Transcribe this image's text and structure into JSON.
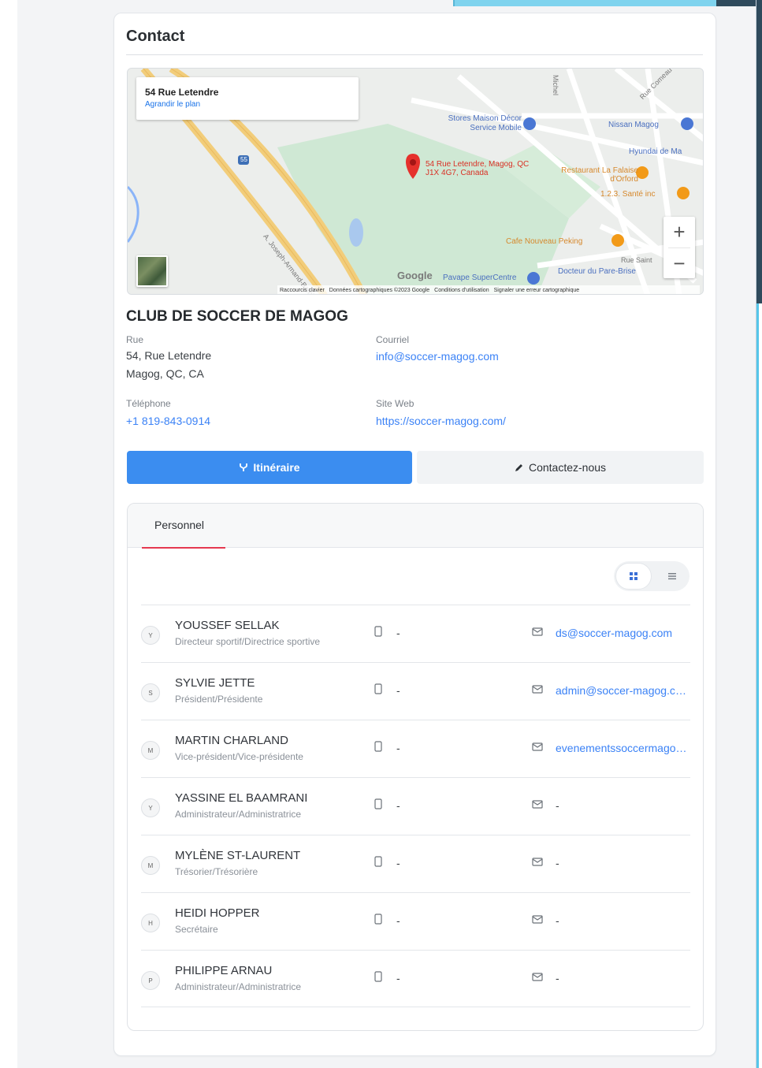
{
  "section": {
    "title": "Contact"
  },
  "map": {
    "info_address": "54 Rue Letendre",
    "info_enlarge": "Agrandir le plan",
    "marker_label": "54 Rue Letendre, Magog, QC J1X 4G7, Canada",
    "pois": [
      "Stores Maison Décor Service Mobile",
      "Nissan Magog",
      "Hyundai de Ma",
      "Restaurant La Falaise d'Orford",
      "1.2.3. Santé inc",
      "Cafe Nouveau Peking",
      "Docteur du Pare-Brise",
      "Pavape SuperCentre"
    ],
    "streets": [
      "A. Joseph-Armand-Bombardier",
      "Rue Saint",
      "Michel",
      "Rue Comeau"
    ],
    "highway": "55",
    "google": "Google",
    "footer": [
      "Raccourcis clavier",
      "Données cartographiques ©2023 Google",
      "Conditions d'utilisation",
      "Signaler une erreur cartographique"
    ],
    "zoom_in": "+",
    "zoom_out": "−"
  },
  "club": {
    "name": "CLUB DE SOCCER DE MAGOG",
    "street_label": "Rue",
    "street_line1": "54, Rue Letendre",
    "street_line2": "Magog, QC, CA",
    "email_label": "Courriel",
    "email": "info@soccer-magog.com",
    "phone_label": "Téléphone",
    "phone": "+1 819-843-0914",
    "website_label": "Site Web",
    "website": "https://soccer-magog.com/"
  },
  "actions": {
    "route": "Itinéraire",
    "contact": "Contactez-nous"
  },
  "staff": {
    "tab": "Personnel",
    "members": [
      {
        "initial": "Y",
        "name": "YOUSSEF SELLAK",
        "role": "Directeur sportif/Directrice sportive",
        "phone": "-",
        "email": "ds@soccer-magog.com"
      },
      {
        "initial": "S",
        "name": "SYLVIE JETTE",
        "role": "Président/Présidente",
        "phone": "-",
        "email": "admin@soccer-magog.com"
      },
      {
        "initial": "M",
        "name": "MARTIN CHARLAND",
        "role": "Vice-président/Vice-présidente",
        "phone": "-",
        "email": "evenementssoccermagog.com"
      },
      {
        "initial": "Y",
        "name": "YASSINE EL BAAMRANI",
        "role": "Administrateur/Administratrice",
        "phone": "-",
        "email": "-"
      },
      {
        "initial": "M",
        "name": "MYLÈNE ST-LAURENT",
        "role": "Trésorier/Trésorière",
        "phone": "-",
        "email": "-"
      },
      {
        "initial": "H",
        "name": "HEIDI HOPPER",
        "role": "Secrétaire",
        "phone": "-",
        "email": "-"
      },
      {
        "initial": "P",
        "name": "PHILIPPE ARNAU",
        "role": "Administrateur/Administratrice",
        "phone": "-",
        "email": "-"
      }
    ]
  },
  "colors": {
    "accent": "#3b8df0",
    "tab_underline": "#e53950",
    "link": "#3b82f6"
  }
}
